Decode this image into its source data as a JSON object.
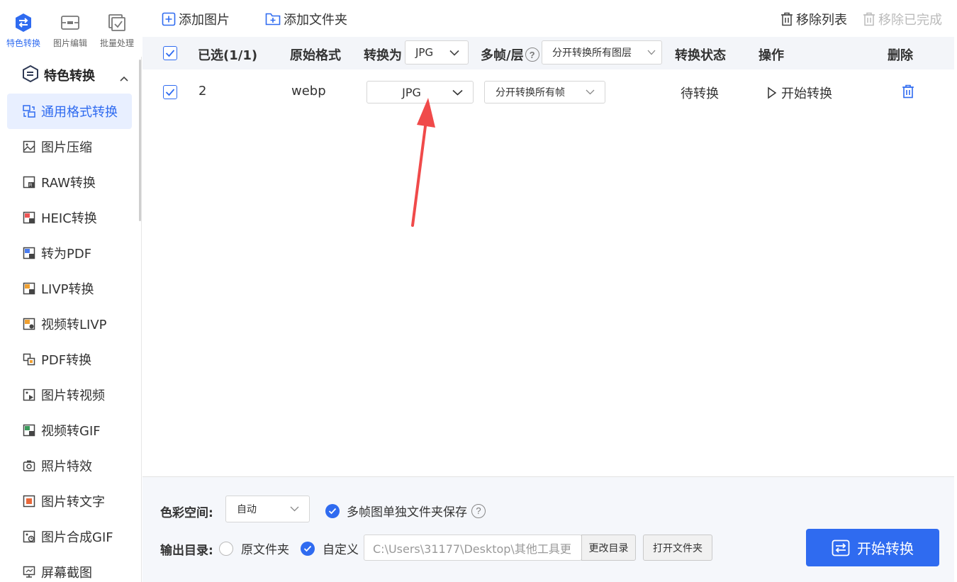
{
  "top_tabs": [
    {
      "label": "特色转换",
      "icon": "swap-circle-icon",
      "active": true
    },
    {
      "label": "图片编辑",
      "icon": "image-edit-icon",
      "active": false
    },
    {
      "label": "批量处理",
      "icon": "batch-check-icon",
      "active": false
    }
  ],
  "sidebar": {
    "section_title": "特色转换",
    "items": [
      {
        "label": "通用格式转换",
        "active": true
      },
      {
        "label": "图片压缩"
      },
      {
        "label": "RAW转换"
      },
      {
        "label": "HEIC转换"
      },
      {
        "label": "转为PDF"
      },
      {
        "label": "LIVP转换"
      },
      {
        "label": "视频转LIVP"
      },
      {
        "label": "PDF转换"
      },
      {
        "label": "图片转视频"
      },
      {
        "label": "视频转GIF"
      },
      {
        "label": "照片特效"
      },
      {
        "label": "图片转文字"
      },
      {
        "label": "图片合成GIF"
      },
      {
        "label": "屏幕截图"
      }
    ]
  },
  "toolbar": {
    "add_image": "添加图片",
    "add_folder": "添加文件夹",
    "remove_list": "移除列表",
    "remove_done": "移除已完成"
  },
  "table": {
    "headers": {
      "selected": "已选(1/1)",
      "original_format": "原始格式",
      "convert_to": "转换为",
      "convert_to_value": "JPG",
      "multiframe": "多帧/层",
      "multiframe_value": "分开转换所有图层",
      "status": "转换状态",
      "action": "操作",
      "delete": "删除"
    },
    "rows": [
      {
        "name": "2",
        "format": "webp",
        "target": "JPG",
        "frames": "分开转换所有帧",
        "status": "待转换",
        "action": "开始转换"
      }
    ]
  },
  "bottom": {
    "color_space_label": "色彩空间:",
    "color_space_value": "自动",
    "multiframe_save": "多帧图单独文件夹保存",
    "output_label": "输出目录:",
    "option_original": "原文件夹",
    "option_custom": "自定义",
    "path": "C:\\Users\\31177\\Desktop\\其他工具更",
    "change_dir": "更改目录",
    "open_folder": "打开文件夹",
    "start": "开始转换"
  },
  "colors": {
    "accent": "#2f6bf0",
    "arrow": "#f04a4a"
  }
}
